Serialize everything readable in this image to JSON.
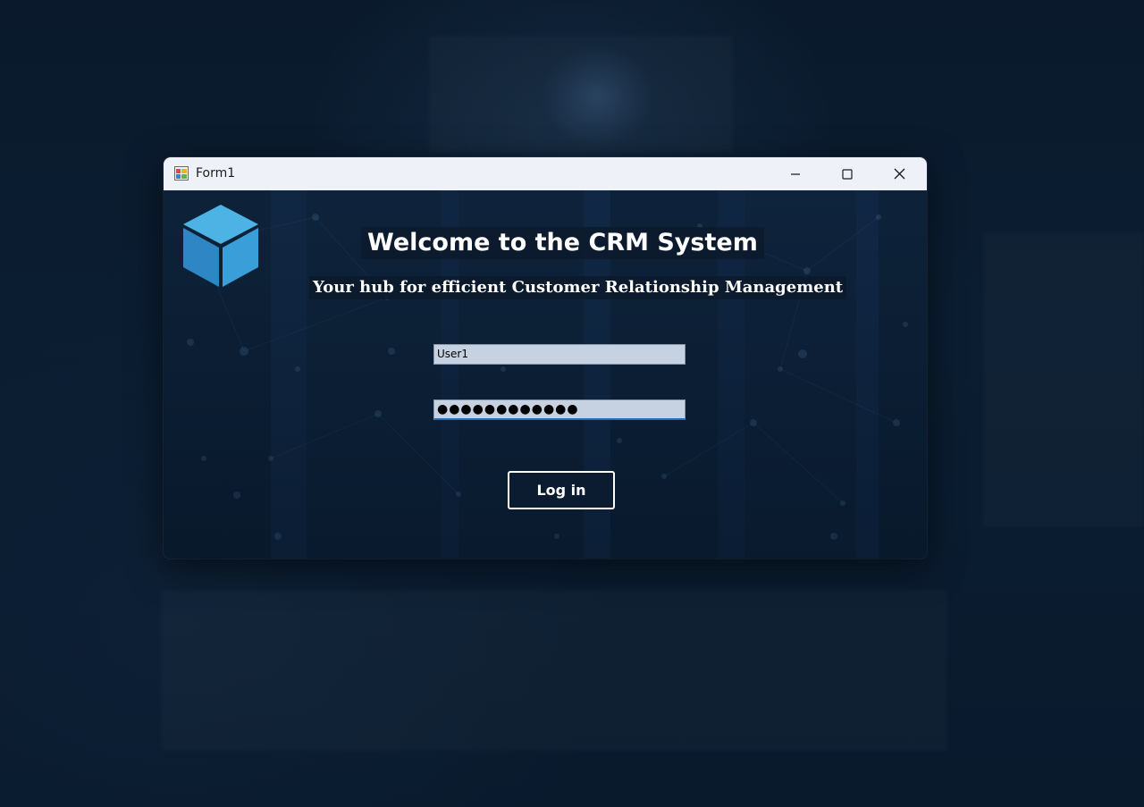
{
  "window": {
    "title": "Form1",
    "app_icon": "winforms-app-icon",
    "controls": {
      "minimize_icon": "minimize-icon",
      "maximize_icon": "maximize-icon",
      "close_icon": "close-icon"
    }
  },
  "login_form": {
    "logo_icon": "cube-logo-icon",
    "heading": "Welcome to the CRM System",
    "subheading": "Your hub for efficient Customer Relationship Management",
    "username_value": "User1",
    "password_value": "●●●●●●●●●●●●",
    "login_button_label": "Log in"
  },
  "colors": {
    "background": "#0b1d31",
    "titlebar": "#eef2f8",
    "field_bg": "#c6d2e1",
    "field_focus_underline": "#1f6fc5",
    "logo_blue": "#3a8fd0",
    "text_light": "#ffffff"
  }
}
